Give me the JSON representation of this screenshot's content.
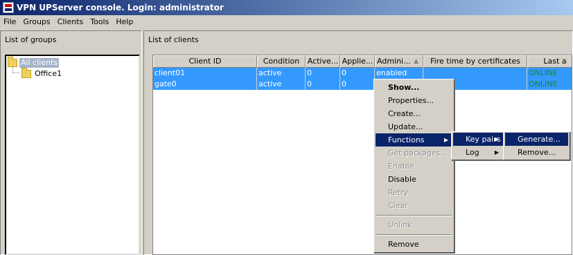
{
  "window": {
    "title": "VPN UPServer console. Login: administrator"
  },
  "menubar": [
    "File",
    "Groups",
    "Clients",
    "Tools",
    "Help"
  ],
  "groups_panel": {
    "caption": "List of groups",
    "tree": {
      "root": "All clients",
      "children": [
        "Office1"
      ]
    }
  },
  "clients_panel": {
    "caption": "List of clients",
    "columns": [
      "Client ID",
      "Condition",
      "Active...",
      "Applie...",
      "Admini...",
      "Fire time by certificates",
      "Last a"
    ],
    "rows": [
      [
        "client01",
        "active",
        "0",
        "0",
        "enabled",
        "",
        "ONLINE"
      ],
      [
        "gate0",
        "active",
        "0",
        "0",
        "",
        "",
        "ONLINE"
      ]
    ]
  },
  "context_menu": {
    "items": [
      "Show...",
      "Properties...",
      "Create...",
      "Update...",
      "Functions",
      "Get packages...",
      "Enable",
      "Disable",
      "Retry",
      "Clear",
      "Unlink",
      "Remove"
    ]
  },
  "functions_submenu": {
    "items": [
      "Key pairs",
      "Log"
    ]
  },
  "keypairs_submenu": {
    "items": [
      "Generate...",
      "Remove..."
    ]
  },
  "colors": {
    "selection": "#3399ff",
    "menu_highlight": "#0a246a",
    "online": "#1a8a1a"
  }
}
